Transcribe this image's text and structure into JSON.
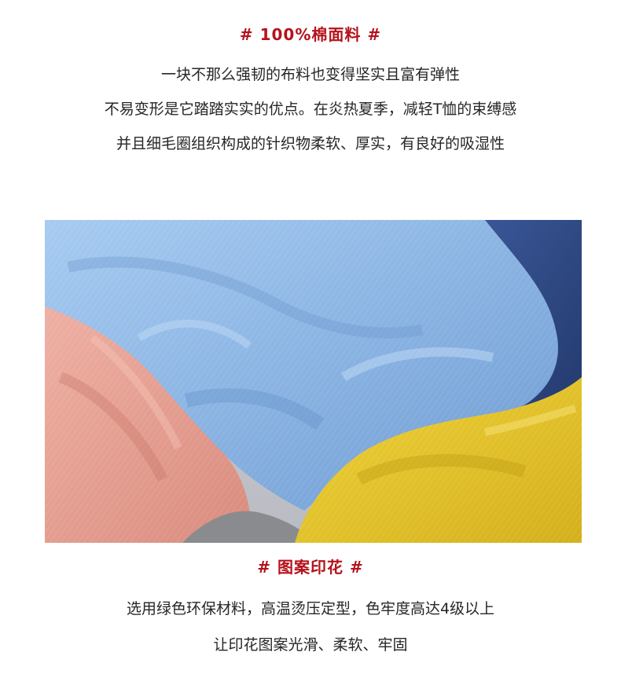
{
  "colors": {
    "accent": "#b5121b",
    "text": "#262626",
    "fabric_blue": "#8fb8e6",
    "fabric_pink": "#e6a194",
    "fabric_yellow": "#e6c62a",
    "fabric_navy": "#33508f",
    "fabric_grey": "#8a8b8f"
  },
  "section1": {
    "title": "# 100%棉面料 #",
    "lines": [
      "一块不那么强韧的布料也变得坚实且富有弹性",
      "不易变形是它踏踏实实的优点。在炎热夏季，减轻T恤的束缚感",
      "并且细毛圈组织构成的针织物柔软、厚实，有良好的吸湿性"
    ]
  },
  "section2": {
    "title": "# 图案印花 #",
    "lines": [
      "选用绿色环保材料，高温烫压定型，色牢度高达4级以上",
      "让印花图案光滑、柔软、牢固"
    ]
  }
}
